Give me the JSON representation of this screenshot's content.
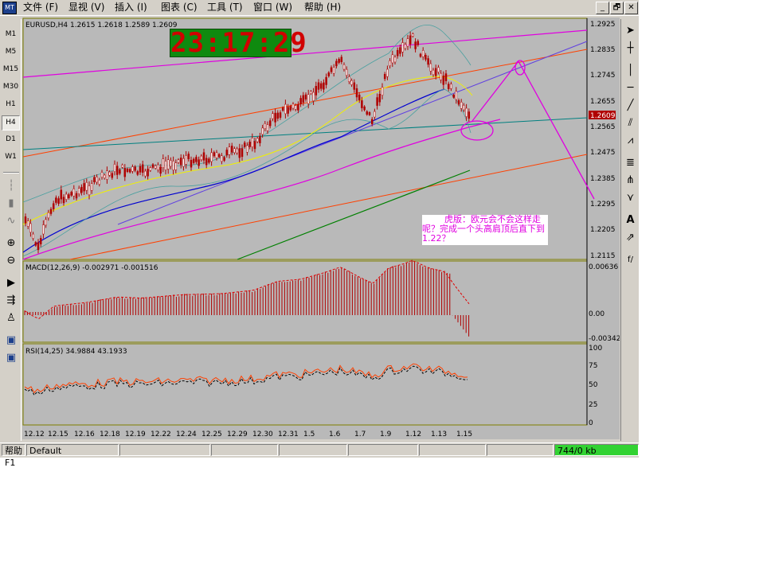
{
  "window": {
    "app_icon_text": "MT",
    "controls": [
      "_",
      "🗗",
      "✕"
    ]
  },
  "menu": [
    {
      "label": "文件 (F)"
    },
    {
      "label": "显视 (V)"
    },
    {
      "label": "插入 (I)"
    },
    {
      "label": "图表 (C)"
    },
    {
      "label": "工具 (T)"
    },
    {
      "label": "窗口 (W)"
    },
    {
      "label": "帮助 (H)"
    }
  ],
  "timeframes": [
    "M1",
    "M5",
    "M15",
    "M30",
    "H1",
    "H4",
    "D1",
    "W1"
  ],
  "active_timeframe": "H4",
  "left_tools": [
    "cursor-icon",
    "bar-chart-icon",
    "candle-icon",
    "line-chart-icon",
    "zoom-in-icon",
    "zoom-out-icon",
    "scroll-icon",
    "autoscroll-icon",
    "template-icon",
    "chart1-icon",
    "chart2-icon"
  ],
  "right_tools": [
    "arrow-icon",
    "crosshair-icon",
    "vline-icon",
    "hline-icon",
    "trendline-icon",
    "channel-icon",
    "fan-icon",
    "fib-icon",
    "pitchfork-icon",
    "gann-icon",
    "text-icon",
    "label-icon",
    "fib-fan-icon"
  ],
  "chart": {
    "symbol_line": "EURUSD,H4  1.2615  1.2618  1.2589  1.2609",
    "clock": "23:17:29",
    "current_price": "1.2609",
    "price_ticks": [
      "1.2925",
      "1.2835",
      "1.2745",
      "1.2655",
      "1.2565",
      "1.2475",
      "1.2385",
      "1.2295",
      "1.2205",
      "1.2115"
    ],
    "annotation": "        虎版：欧元会不会这样走呢？完成一个头高肩顶后直下到1.22？",
    "macd_label": "MACD(12,26,9)   -0.002971  -0.001516",
    "macd_ticks": [
      "0.00636",
      "0.00",
      "-0.00342"
    ],
    "rsi_label": "RSI(14,25)  34.9884  43.1933",
    "rsi_ticks": [
      "100",
      "75",
      "50",
      "25",
      "0"
    ],
    "date_ticks": [
      "12.12",
      "12.15",
      "12.16",
      "12.18",
      "12.19",
      "12.22",
      "12.24",
      "12.25",
      "12.29",
      "12.30",
      "12.31",
      "1.5",
      "1.6",
      "1.7",
      "1.9",
      "1.12",
      "1.13",
      "1.15"
    ],
    "colors": {
      "bg": "#b9b9b9",
      "candle": "#b00000",
      "ma_blue": "#0000d0",
      "ma_yellow": "#f0f000",
      "ma_magenta": "#e000e0",
      "ma_green": "#008000",
      "trend_red": "#ff4000",
      "trend_teal": "#008080",
      "bollinger": "#4aa0a0",
      "axis_text": "#000000"
    }
  },
  "status": {
    "left": "帮助 F1",
    "profile": "Default",
    "traffic": "744/0 kb"
  }
}
